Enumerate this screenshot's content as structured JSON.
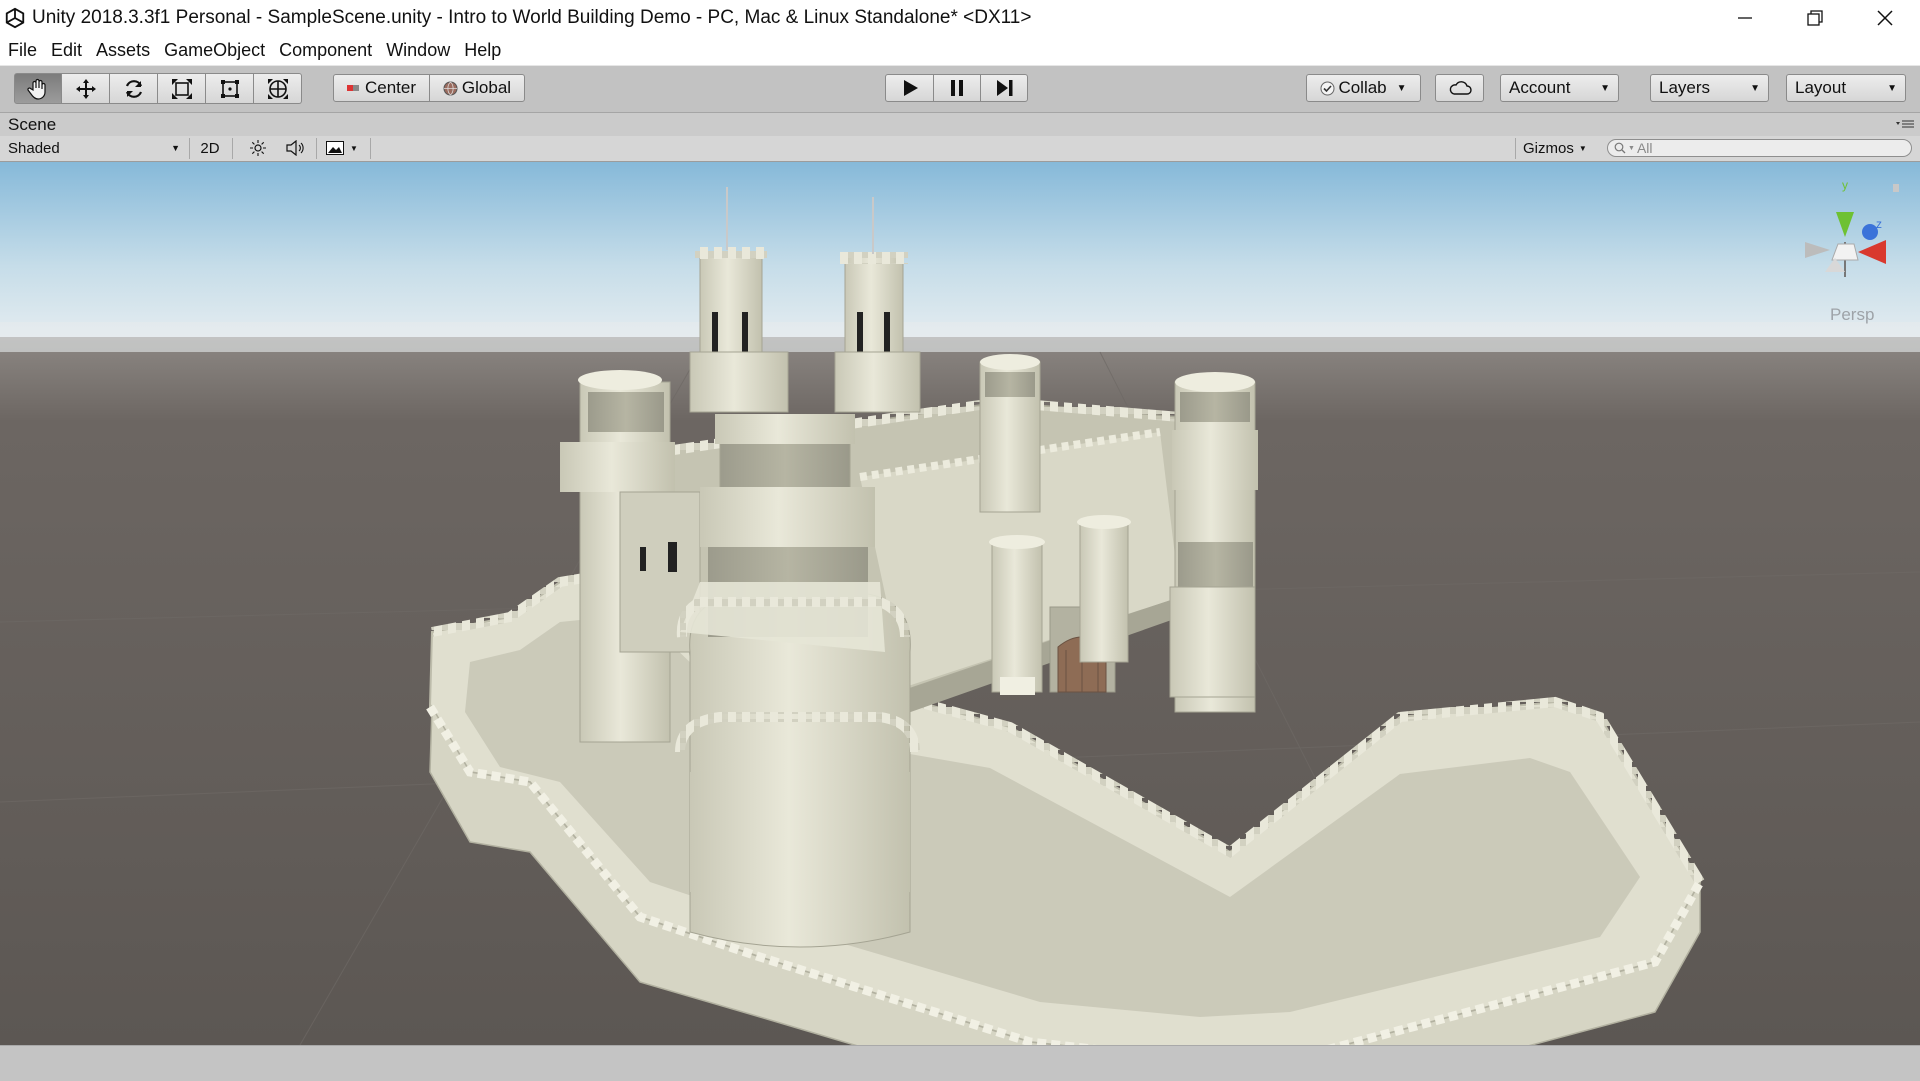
{
  "window": {
    "title": "Unity 2018.3.3f1 Personal - SampleScene.unity - Intro to World Building Demo - PC, Mac & Linux Standalone* <DX11>"
  },
  "menu": [
    "File",
    "Edit",
    "Assets",
    "GameObject",
    "Component",
    "Window",
    "Help"
  ],
  "toolbar": {
    "pivot_mode": "Center",
    "pivot_rotation": "Global",
    "collab": "Collab",
    "account": "Account",
    "layers": "Layers",
    "layout": "Layout"
  },
  "scene": {
    "tab_label": "Scene",
    "draw_mode": "Shaded",
    "mode_2d": "2D",
    "gizmos": "Gizmos",
    "search_placeholder": "All",
    "projection": "Persp",
    "gizmo_axes": {
      "y": "y",
      "z": "z"
    }
  },
  "icons": {
    "tools": [
      "hand-icon",
      "move-icon",
      "rotate-icon",
      "scale-icon",
      "rect-transform-icon",
      "transform-icon"
    ],
    "playback": [
      "play-icon",
      "pause-icon",
      "step-icon"
    ]
  },
  "colors": {
    "sky_top": "#86b9d9",
    "horizon": "#eaeff1",
    "ground": "#5c5753",
    "stone": "#e3e2d2",
    "gizmo_y": "#6ec133",
    "gizmo_z": "#3b73d9",
    "gizmo_x": "#d9392e"
  }
}
